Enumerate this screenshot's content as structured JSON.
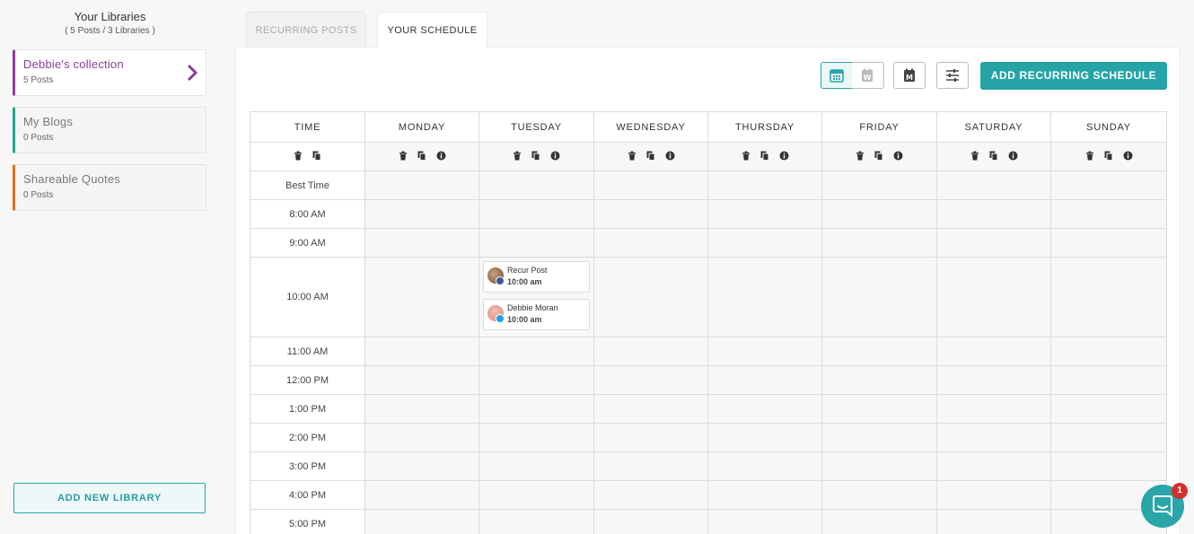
{
  "sidebar": {
    "title": "Your Libraries",
    "subtitle": "( 5 Posts / 3 Libraries )",
    "libraries": [
      {
        "name": "Debbie's collection",
        "count": "5 Posts",
        "color": "#8b3d9b"
      },
      {
        "name": "My Blogs",
        "count": "0 Posts",
        "color": "#22a68a"
      },
      {
        "name": "Shareable Quotes",
        "count": "0 Posts",
        "color": "#e07020"
      }
    ],
    "add_label": "ADD NEW LIBRARY"
  },
  "tabs": [
    {
      "label": "RECURRING POSTS"
    },
    {
      "label": "YOUR SCHEDULE"
    }
  ],
  "toolbar": {
    "add_recurring_label": "ADD RECURRING SCHEDULE",
    "icons": [
      "week-view-icon",
      "w-calendar-icon",
      "m-calendar-icon",
      "filter-sliders-icon"
    ]
  },
  "schedule": {
    "time_header": "TIME",
    "days": [
      "MONDAY",
      "TUESDAY",
      "WEDNESDAY",
      "THURSDAY",
      "FRIDAY",
      "SATURDAY",
      "SUNDAY"
    ],
    "slots": [
      "Best Time",
      "8:00 AM",
      "9:00 AM",
      "10:00 AM",
      "11:00 AM",
      "12:00 PM",
      "1:00 PM",
      "2:00 PM",
      "3:00 PM",
      "4:00 PM",
      "5:00 PM"
    ],
    "posts": [
      {
        "title": "Recur Post",
        "time": "10:00 am",
        "network": "facebook",
        "network_color": "#3b5998"
      },
      {
        "title": "Debbie Moran",
        "time": "10:00 am",
        "network": "twitter",
        "network_color": "#1da1f2"
      }
    ]
  },
  "chat": {
    "badge": "1"
  }
}
